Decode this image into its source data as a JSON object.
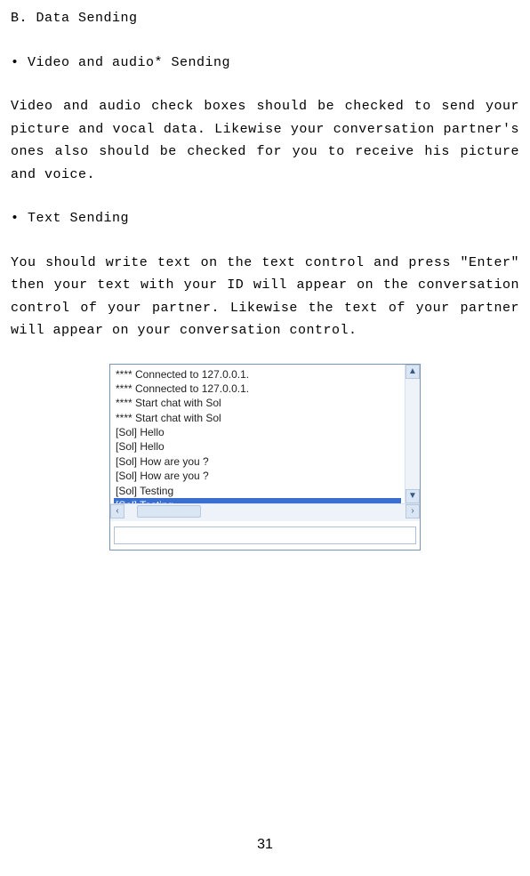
{
  "doc": {
    "section_title": "B. Data Sending",
    "bullet1": "• Video and audio* Sending",
    "para1": "Video and audio check boxes should be checked to send your picture and vocal data. Likewise your conversation partner's ones also should be checked for you to receive his picture and voice.",
    "bullet2": "• Text Sending",
    "para2": "You should write text on the text control and press \"Enter\" then your text with your ID will appear on the conversation control of your partner. Likewise the text of your partner will appear on your conversation control.",
    "page_number": "31"
  },
  "chat": {
    "lines": [
      "**** Connected to 127.0.0.1.",
      "**** Connected to 127.0.0.1.",
      "**** Start chat with Sol",
      "**** Start chat with Sol",
      "[Sol] Hello",
      "[Sol] Hello",
      "[Sol] How are you ?",
      "[Sol] How are you ?",
      "[Sol] Testing",
      "[Sol] Testing"
    ],
    "selected_index": 9,
    "input_value": "",
    "vsb_up": "▲",
    "vsb_down": "▼",
    "hsb_left": "‹",
    "hsb_right": "›"
  }
}
